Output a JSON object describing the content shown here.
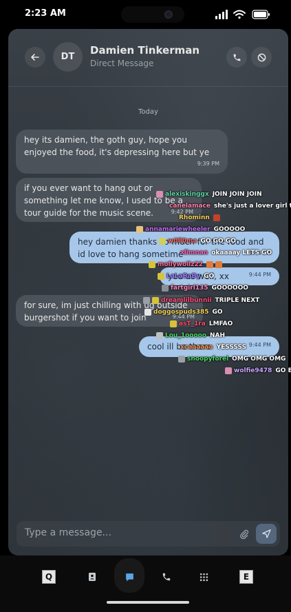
{
  "status_bar": {
    "time": "2:23 AM"
  },
  "header": {
    "avatar_initials": "DT",
    "contact_name": "Damien Tinkerman",
    "subtitle": "Direct Message"
  },
  "day_separator": "Today",
  "messages": [
    {
      "text": "hey its damien, the goth guy, hope you enjoyed the food, it's depressing here but ye",
      "time": "9:39 PM",
      "direction": "incoming"
    },
    {
      "text": "if you ever want to hang out or something let me know, I used to be a tour guide for the music scene.",
      "time": "9:42 PM",
      "direction": "incoming"
    },
    {
      "text": "hey damien thanks so much for the food and id love to hang sometime",
      "time": "9:44 PM",
      "direction": "outgoing"
    },
    {
      "text": "you as well, xx",
      "time": "9:44 PM",
      "direction": "outgoing"
    },
    {
      "text": "for sure, im just chilling with ug outside burgershot if you want to join",
      "time": "9:44 PM",
      "direction": "incoming"
    },
    {
      "text": "cool ill be there",
      "time": "9:44 PM",
      "direction": "outgoing"
    }
  ],
  "composer": {
    "placeholder": "Type a message..."
  },
  "nav": {
    "tiles": [
      "Q",
      "E"
    ]
  },
  "chat_overlay": [
    {
      "user": "alexiskinggx",
      "msg": "JOIN JOIN JOIN",
      "color": "#5fd3a0"
    },
    {
      "user": "canelamace",
      "msg": "she's just a lover girl tee",
      "color": "#ff7fa8"
    },
    {
      "user": "Rhominn",
      "msg": "",
      "color": "#f4d35e"
    },
    {
      "user": "annamariewheeler",
      "msg": "GOOOOO",
      "color": "#c06cf0"
    },
    {
      "user": "w0ll0ma",
      "msg": "GO GO GO",
      "color": "#ff6b6b"
    },
    {
      "user": "xlimnan",
      "msg": "okaaaay LETS GO",
      "color": "#ff5cb0"
    },
    {
      "user": "mollywollz22",
      "msg": "",
      "color": "#ff6ba0"
    },
    {
      "user": "LaLaBaBy",
      "msg": "GO",
      "color": "#9d7bff"
    },
    {
      "user": "fartgirl135",
      "msg": "GOOOOOO",
      "color": "#ff85c0"
    },
    {
      "user": "dreamlilbunnii",
      "msg": "TRIPLE NEXT",
      "color": "#ff4d7a"
    },
    {
      "user": "doggospuds385",
      "msg": "GO",
      "color": "#f4d35e"
    },
    {
      "user": "asT_1ra",
      "msg": "LMFAO",
      "color": "#ff4d6d"
    },
    {
      "user": "Lou_1ooooo",
      "msg": "NAH",
      "color": "#4cd964"
    },
    {
      "user": "xcaaaaaa",
      "msg": "YESSSSS",
      "color": "#ff8c42"
    },
    {
      "user": "snoopyforel",
      "msg": "OMG OMG OMG",
      "color": "#4cd964"
    },
    {
      "user": "wolfie9478",
      "msg": "GO BI",
      "color": "#c9a5ff"
    }
  ]
}
